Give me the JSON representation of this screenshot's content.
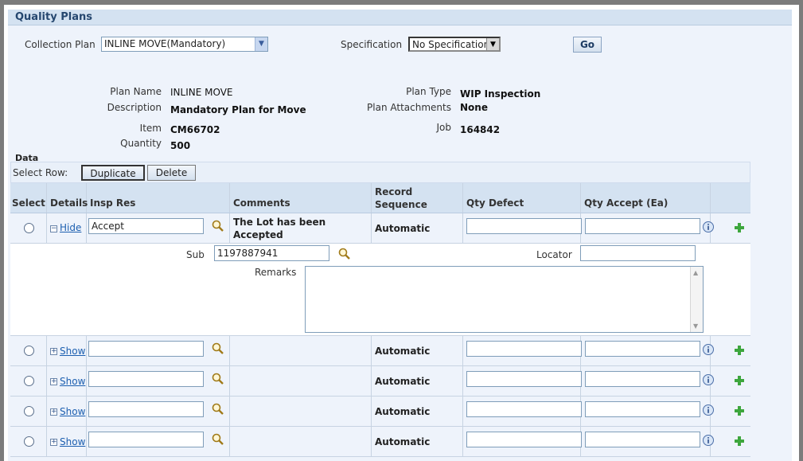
{
  "header": {
    "title": "Quality Plans"
  },
  "filters": {
    "collection_plan_label": "Collection Plan",
    "collection_plan_value": "INLINE MOVE(Mandatory)",
    "specification_label": "Specification",
    "specification_value": "No Specification",
    "go_label": "Go"
  },
  "plan": {
    "plan_name_label": "Plan Name",
    "plan_name": "INLINE MOVE",
    "description_label": "Description",
    "description": "Mandatory Plan for Move",
    "item_label": "Item",
    "item": "CM66702",
    "quantity_label": "Quantity",
    "quantity": "500",
    "plan_type_label": "Plan Type",
    "plan_type": "WIP Inspection",
    "attachments_label": "Plan Attachments",
    "attachments": "None",
    "job_label": "Job",
    "job": "164842"
  },
  "data": {
    "section_label": "Data",
    "select_row_label": "Select Row:",
    "duplicate_label": "Duplicate",
    "delete_label": "Delete",
    "columns": {
      "select": "Select",
      "details": "Details",
      "insp_res": "Insp Res",
      "comments": "Comments",
      "record_sequence": "Record Sequence",
      "qty_defect": "Qty Defect",
      "qty_accept": "Qty Accept (Ea)"
    },
    "rows": [
      {
        "toggle": "Hide",
        "insp_res": "Accept",
        "comments": "The Lot has been Accepted",
        "record_sequence": "Automatic"
      },
      {
        "toggle": "Show",
        "insp_res": "",
        "comments": "",
        "record_sequence": "Automatic"
      },
      {
        "toggle": "Show",
        "insp_res": "",
        "comments": "",
        "record_sequence": "Automatic"
      },
      {
        "toggle": "Show",
        "insp_res": "",
        "comments": "",
        "record_sequence": "Automatic"
      },
      {
        "toggle": "Show",
        "insp_res": "",
        "comments": "",
        "record_sequence": "Automatic"
      }
    ],
    "detail": {
      "sub_label": "Sub",
      "sub_value": "1197887941",
      "locator_label": "Locator",
      "locator_value": "",
      "remarks_label": "Remarks",
      "remarks_value": ""
    }
  }
}
